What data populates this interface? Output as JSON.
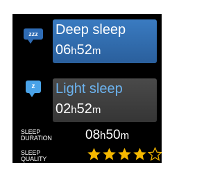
{
  "deep_sleep": {
    "icon_text": "zzz",
    "title": "Deep sleep",
    "hours": "06",
    "hours_unit": "h",
    "minutes": "52",
    "minutes_unit": "m"
  },
  "light_sleep": {
    "icon_text": "z",
    "title": "Light sleep",
    "hours": "02",
    "hours_unit": "h",
    "minutes": "52",
    "minutes_unit": "m"
  },
  "sleep_duration": {
    "label_line1": "SLEEP",
    "label_line2": "DURATION",
    "hours": "08",
    "hours_unit": "h",
    "minutes": "50",
    "minutes_unit": "m"
  },
  "sleep_quality": {
    "label_line1": "SLEEP",
    "label_line2": "QUALITY",
    "rating": 4,
    "max_rating": 5,
    "icon": "star-icon"
  },
  "colors": {
    "background": "#000000",
    "deep_card": "#2a5f9c",
    "light_card": "#3d3d3d",
    "light_title": "#6cb3ef",
    "star_filled": "#f5b800",
    "star_empty": "#f5b800"
  }
}
